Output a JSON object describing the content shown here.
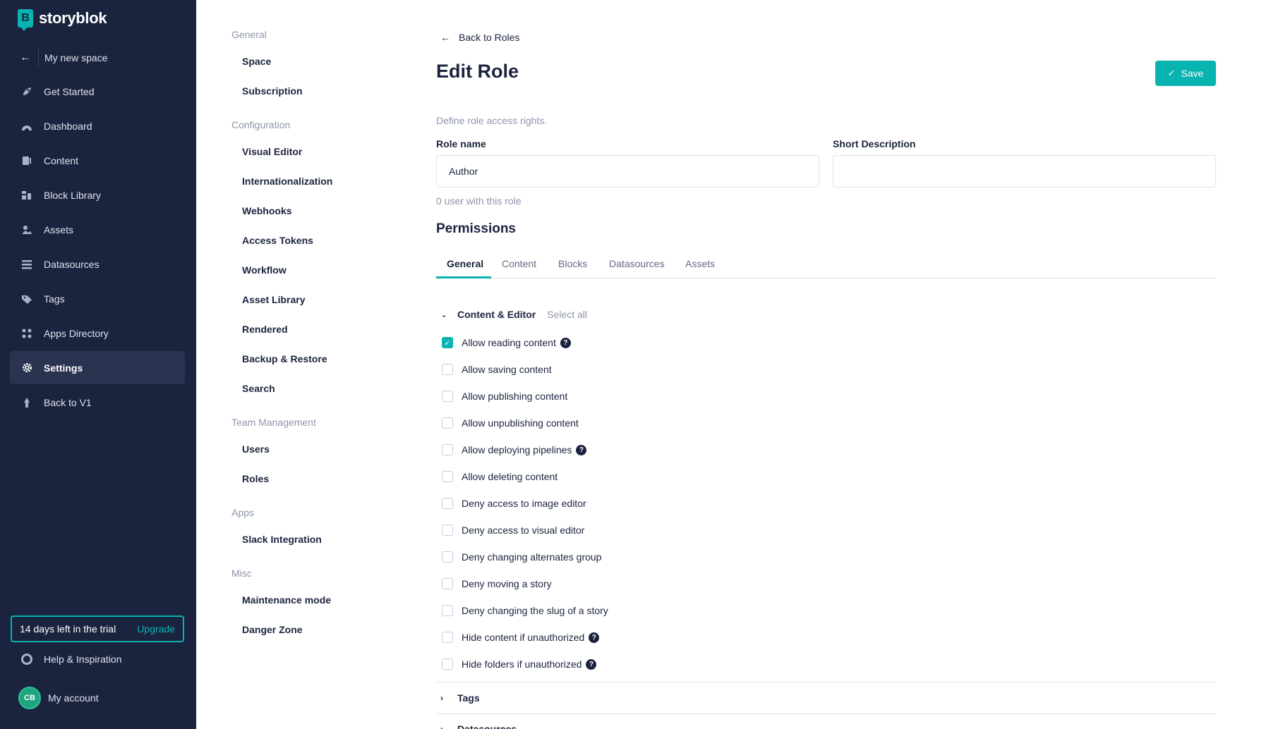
{
  "colors": {
    "sidebar_bg": "#1b243f",
    "accent": "#09b3af",
    "text": "#1b243f",
    "muted": "#8d95aa"
  },
  "sidebar": {
    "brand": "storyblok",
    "space": "My new space",
    "items": [
      {
        "label": "Get Started",
        "icon": "rocket-icon"
      },
      {
        "label": "Dashboard",
        "icon": "dashboard-icon"
      },
      {
        "label": "Content",
        "icon": "content-icon"
      },
      {
        "label": "Block Library",
        "icon": "blocks-icon"
      },
      {
        "label": "Assets",
        "icon": "assets-icon"
      },
      {
        "label": "Datasources",
        "icon": "datasources-icon"
      },
      {
        "label": "Tags",
        "icon": "tag-icon"
      },
      {
        "label": "Apps Directory",
        "icon": "apps-icon"
      },
      {
        "label": "Settings",
        "icon": "gear-icon",
        "active": true
      },
      {
        "label": "Back to V1",
        "icon": "back-v1-icon"
      }
    ],
    "trial_text": "14 days left in the trial",
    "upgrade": "Upgrade",
    "help": "Help & Inspiration",
    "avatar_initials": "CB",
    "account": "My account"
  },
  "settings_menu": {
    "general_title": "General",
    "general": [
      "Space",
      "Subscription"
    ],
    "configuration_title": "Configuration",
    "configuration": [
      "Visual Editor",
      "Internationalization",
      "Webhooks",
      "Access Tokens",
      "Workflow",
      "Asset Library",
      "Rendered",
      "Backup & Restore",
      "Search"
    ],
    "team_title": "Team Management",
    "team": [
      "Users",
      "Roles"
    ],
    "apps_title": "Apps",
    "apps": [
      "Slack Integration"
    ],
    "misc_title": "Misc",
    "misc": [
      "Maintenance mode",
      "Danger Zone"
    ]
  },
  "main": {
    "back": "Back to Roles",
    "title": "Edit Role",
    "save": "Save",
    "hint": "Define role access rights.",
    "role_name_label": "Role name",
    "role_name_value": "Author",
    "short_desc_label": "Short Description",
    "short_desc_value": "",
    "users_count": "0 user with this role",
    "permissions_title": "Permissions",
    "tabs": [
      "General",
      "Content",
      "Blocks",
      "Datasources",
      "Assets"
    ],
    "active_tab": "General",
    "section_name": "Content & Editor",
    "select_all": "Select all",
    "permissions": [
      {
        "label": "Allow reading content",
        "checked": true,
        "help": true
      },
      {
        "label": "Allow saving content",
        "checked": false,
        "help": false
      },
      {
        "label": "Allow publishing content",
        "checked": false,
        "help": false
      },
      {
        "label": "Allow unpublishing content",
        "checked": false,
        "help": false
      },
      {
        "label": "Allow deploying pipelines",
        "checked": false,
        "help": true
      },
      {
        "label": "Allow deleting content",
        "checked": false,
        "help": false
      },
      {
        "label": "Deny access to image editor",
        "checked": false,
        "help": false
      },
      {
        "label": "Deny access to visual editor",
        "checked": false,
        "help": false
      },
      {
        "label": "Deny changing alternates group",
        "checked": false,
        "help": false
      },
      {
        "label": "Deny moving a story",
        "checked": false,
        "help": false
      },
      {
        "label": "Deny changing the slug of a story",
        "checked": false,
        "help": false
      },
      {
        "label": "Hide content if unauthorized",
        "checked": false,
        "help": true
      },
      {
        "label": "Hide folders if unauthorized",
        "checked": false,
        "help": true
      }
    ],
    "collapsed_sections": [
      "Tags",
      "Datasources"
    ]
  }
}
